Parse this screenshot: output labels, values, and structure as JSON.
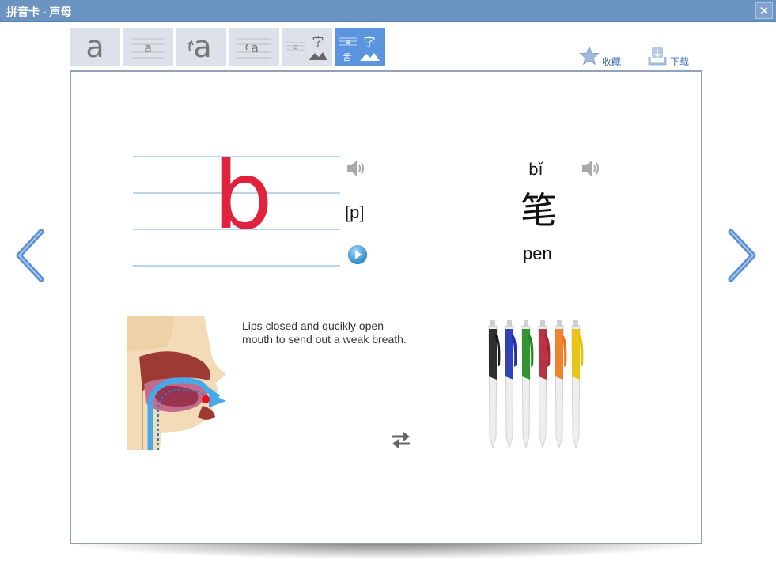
{
  "window": {
    "title": "拼音卡 - 声母",
    "close_icon": "close-icon"
  },
  "tabs": [
    {
      "id": "letter-large",
      "glyph": "a",
      "active": false
    },
    {
      "id": "letter-lined",
      "glyph": "a",
      "active": false
    },
    {
      "id": "letter-stroke",
      "glyph": "a",
      "active": false
    },
    {
      "id": "letter-stroke-lined",
      "glyph": "a",
      "active": false
    },
    {
      "id": "letter-char-picture",
      "glyph_small": "a",
      "char": "字",
      "active": false
    },
    {
      "id": "letter-tongue-char-picture",
      "glyph_small": "a",
      "char": "字",
      "tongue": "舌",
      "active": true
    }
  ],
  "toolbar": {
    "favorite_label": "收藏",
    "download_label": "下载"
  },
  "card": {
    "letter": "b",
    "ipa": "[p]",
    "pinyin": "bǐ",
    "hanzi": "笔",
    "word": "pen",
    "description": "Lips closed and qucikly open mouth to send out a weak breath."
  },
  "colors": {
    "titlebar": "#6c94c2",
    "active_tab": "#5b95df",
    "letter": "#e0223d",
    "guide_lines": "#9fc8e8",
    "link_text": "#3a6ea8"
  },
  "icons": {
    "speaker": "speaker-icon",
    "play": "play-icon",
    "swap": "swap-icon",
    "star": "star-icon",
    "download": "download-icon",
    "prev": "chevron-left-icon",
    "next": "chevron-right-icon"
  },
  "pens": [
    {
      "color": "#1a1a1a"
    },
    {
      "color": "#1f2fb0"
    },
    {
      "color": "#1f8a1f"
    },
    {
      "color": "#b02030"
    },
    {
      "color": "#f07818"
    },
    {
      "color": "#e8c000"
    }
  ]
}
